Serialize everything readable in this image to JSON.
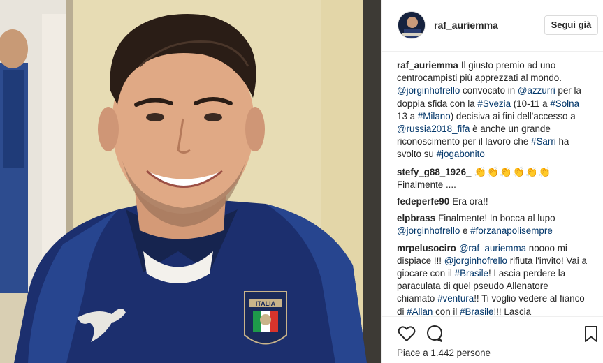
{
  "header": {
    "username": "raf_auriemma",
    "follow_label": "Segui già"
  },
  "caption": {
    "user": "raf_auriemma",
    "parts": [
      {
        "t": "Il giusto premio ad uno centrocampisti più apprezzati al mondo. ",
        "link": false
      },
      {
        "t": "@jorginhofrello",
        "link": true
      },
      {
        "t": " convocato in ",
        "link": false
      },
      {
        "t": "@azzurri",
        "link": true
      },
      {
        "t": " per la doppia sfida con la ",
        "link": false
      },
      {
        "t": "#Svezia",
        "link": true
      },
      {
        "t": " (10-11 a ",
        "link": false
      },
      {
        "t": "#Solna",
        "link": true
      },
      {
        "t": " 13 a ",
        "link": false
      },
      {
        "t": "#Milano",
        "link": true
      },
      {
        "t": ") decisiva ai fini dell'accesso a ",
        "link": false
      },
      {
        "t": "@russia2018_fifa",
        "link": true
      },
      {
        "t": " è anche un grande riconoscimento per il lavoro che ",
        "link": false
      },
      {
        "t": "#Sarri",
        "link": true
      },
      {
        "t": " ha svolto su ",
        "link": false
      },
      {
        "t": "#jogabonito",
        "link": true
      }
    ]
  },
  "comments": [
    {
      "user": "stefy_g88_1926_",
      "emoji": "👏👏👏👏👏👏",
      "parts": [
        {
          "t": "Finalmente ....",
          "link": false
        }
      ]
    },
    {
      "user": "fedeperfe90",
      "parts": [
        {
          "t": "Era ora!!",
          "link": false
        }
      ]
    },
    {
      "user": "elpbrass",
      "parts": [
        {
          "t": "Finalmente! In bocca al lupo ",
          "link": false
        },
        {
          "t": "@jorginhofrello",
          "link": true
        },
        {
          "t": " e ",
          "link": false
        },
        {
          "t": "#forzanapolisempre",
          "link": true
        }
      ]
    },
    {
      "user": "mrpelusociro",
      "parts": [
        {
          "t": "@raf_auriemma",
          "link": true
        },
        {
          "t": " noooo mi dispiace !!! ",
          "link": false
        },
        {
          "t": "@jorginhofrello",
          "link": true
        },
        {
          "t": " rifiuta l'invito! Vai a giocare con il ",
          "link": false
        },
        {
          "t": "#Brasile",
          "link": true
        },
        {
          "t": "! Lascia perdere la paraculata di quel pseudo Allenatore chiamato ",
          "link": false
        },
        {
          "t": "#ventura",
          "link": true
        },
        {
          "t": "!! Ti voglio vedere al fianco di ",
          "link": false
        },
        {
          "t": "#Allan",
          "link": true
        },
        {
          "t": " con il ",
          "link": false
        },
        {
          "t": "#Brasile",
          "link": true
        },
        {
          "t": "!!! Lascia",
          "link": false
        }
      ]
    }
  ],
  "footer": {
    "likes_text": "Piace a 1.442 persone"
  },
  "badge": {
    "text": "ITALIA"
  },
  "icons": {
    "like": "heart-icon",
    "comment": "comment-icon",
    "save": "bookmark-icon"
  },
  "colors": {
    "link": "#003569",
    "text": "#262626",
    "shirt": "#1c2f6e"
  }
}
